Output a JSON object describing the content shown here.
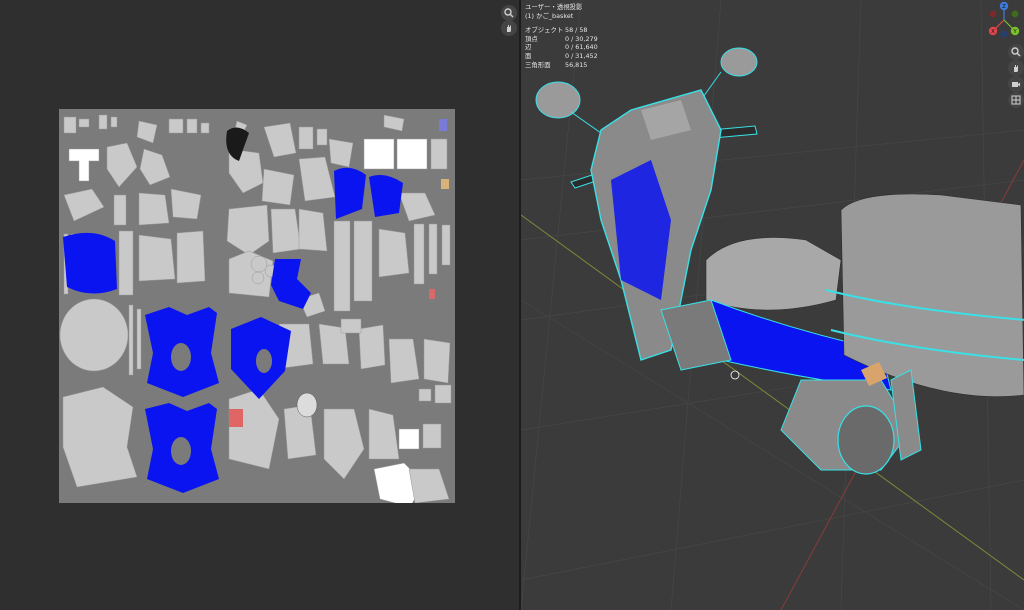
{
  "viewport": {
    "header_line1": "ユーザー・透視投影",
    "header_line2": "(1) かご_basket",
    "stats": [
      {
        "label": "オブジェクト",
        "value": "58 / 58"
      },
      {
        "label": "頂点",
        "value": "0 / 30,279"
      },
      {
        "label": "辺",
        "value": "0 / 61,640"
      },
      {
        "label": "面",
        "value": "0 / 31,452"
      },
      {
        "label": "三角形面",
        "value": "56,815"
      }
    ],
    "gizmo_axes": {
      "x": "X",
      "y": "Y",
      "z": "Z"
    },
    "axis_colors": {
      "x": "#e2454c",
      "y": "#7ac12b",
      "z": "#3f7bdb"
    }
  },
  "uv_editor": {
    "background": "#2f2f2f",
    "texture_gray": "#7b7b7b",
    "highlight_blue": "#0a14f0"
  },
  "icons": {
    "uv_zoom": "magnifier-icon",
    "uv_pan": "hand-icon",
    "vp_zoom": "magnifier-icon",
    "vp_pan": "hand-icon",
    "camera": "camera-icon",
    "grid": "grid-icon"
  }
}
